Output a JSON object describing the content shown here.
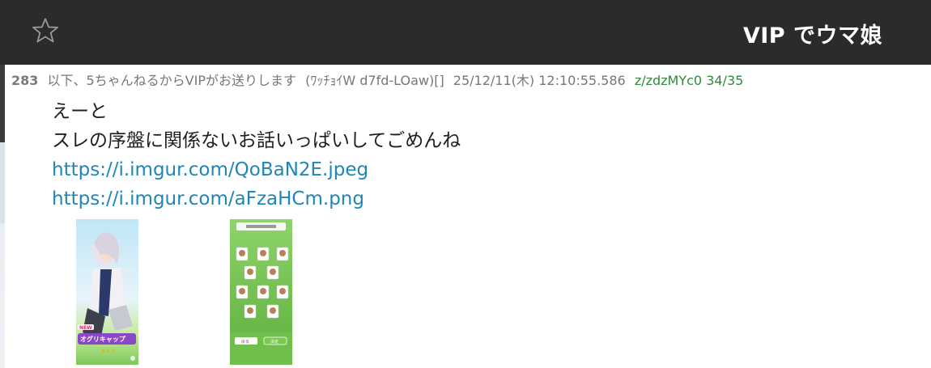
{
  "topbar": {
    "title": "VIP でウマ娘",
    "favorite_icon": "star-outline-icon"
  },
  "post": {
    "number": "283",
    "name": "以下、5ちゃんねるからVIPがお送りします",
    "trip": "(ﾜｯﾁｮｲW d7fd-LOaw)[]",
    "datetime": "25/12/11(木) 12:10:55.586",
    "id_count": "z/zdzMYc0 34/35",
    "body_lines": [
      "えーと",
      "スレの序盤に関係ないお話いっぱいしてごめんね"
    ],
    "links": [
      "https://i.imgur.com/QoBaN2E.jpeg",
      "https://i.imgur.com/aFzaHCm.png"
    ],
    "thumbnails": [
      {
        "name": "thumbnail-oguri-cap",
        "badge": "NEW",
        "caption": "オグリキャップ"
      },
      {
        "name": "thumbnail-umamusume-list",
        "button_left": "戻る",
        "button_right": "決定"
      }
    ]
  },
  "colors": {
    "topbar_bg": "#2b2b2b",
    "link": "#1f86b5",
    "id_green": "#2e8b3a",
    "meta_gray": "#777777"
  }
}
